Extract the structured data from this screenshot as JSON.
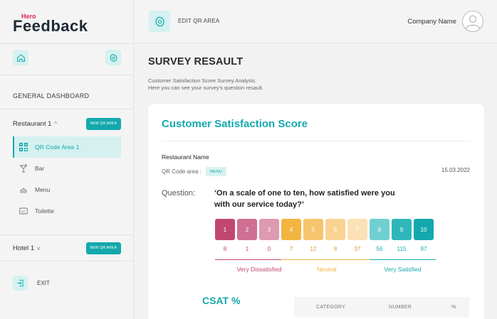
{
  "brand": {
    "hero": "Hero",
    "name": "Feedback"
  },
  "sidebar": {
    "heading": "GENERAL DASHBOARD",
    "groups": [
      {
        "label": "Restaurant 1",
        "chevron": "^",
        "button": "NEW QR AREA"
      },
      {
        "label": "Hotel 1",
        "chevron": "v",
        "button": "NEW QR AREA"
      }
    ],
    "items": [
      {
        "label": "QR Code Area 1",
        "icon": "qr-code-icon",
        "active": true
      },
      {
        "label": "Bar",
        "icon": "cocktail-icon",
        "active": false
      },
      {
        "label": "Menu",
        "icon": "dish-icon",
        "active": false
      },
      {
        "label": "Toilette",
        "icon": "wc-icon",
        "active": false
      }
    ],
    "exit_label": "EXIT"
  },
  "topbar": {
    "edit_label": "EDIT QR AREA",
    "company": "Company Name"
  },
  "page": {
    "title": "SURVEY RESAULT",
    "desc_line1": "Customer Satisfaction Score Survey Analysis.",
    "desc_line2": "Here you can see your survey's question resault."
  },
  "card": {
    "title": "Customer Satisfaction Score",
    "restaurant_label": "Restaurant Name",
    "qr_label": "QR Code area :",
    "qr_value": "MENU",
    "date": "15.03.2022",
    "question_label": "Question:",
    "question_line1": "‘On a scale of one to ten, how satisfied were you",
    "question_line2": "with our service today?’",
    "scale": [
      {
        "n": "1",
        "count": "8",
        "color": "#c1476f",
        "text": "#c1476f"
      },
      {
        "n": "2",
        "count": "1",
        "color": "#cf6f91",
        "text": "#c1476f"
      },
      {
        "n": "3",
        "count": "0",
        "color": "#dd9ab1",
        "text": "#c1476f"
      },
      {
        "n": "4",
        "count": "7",
        "color": "#f2b53f",
        "text": "#e59a2c"
      },
      {
        "n": "5",
        "count": "12",
        "color": "#f5c46c",
        "text": "#e59a2c"
      },
      {
        "n": "6",
        "count": "8",
        "color": "#f8d392",
        "text": "#e59a2c"
      },
      {
        "n": "7",
        "count": "37",
        "color": "#fbe1b5",
        "text": "#e59a2c"
      },
      {
        "n": "8",
        "count": "56",
        "color": "#6fcfd1",
        "text": "#14a8ad"
      },
      {
        "n": "9",
        "count": "115",
        "color": "#2fb6bb",
        "text": "#14a8ad"
      },
      {
        "n": "10",
        "count": "97",
        "color": "#14a8ad",
        "text": "#14a8ad"
      }
    ],
    "bands": [
      {
        "label": "Very Dissatisfied",
        "color": "#c1476f"
      },
      {
        "label": "Neutral",
        "color": "#f2b53f"
      },
      {
        "label": "Very Satisfied",
        "color": "#14a8ad"
      }
    ],
    "csat_title": "CSAT %",
    "table_headers": [
      "CATEGORY",
      "NUMBER",
      "%"
    ]
  },
  "colors": {
    "accent": "#14a8ad",
    "accent_light": "#d5f1f0"
  }
}
